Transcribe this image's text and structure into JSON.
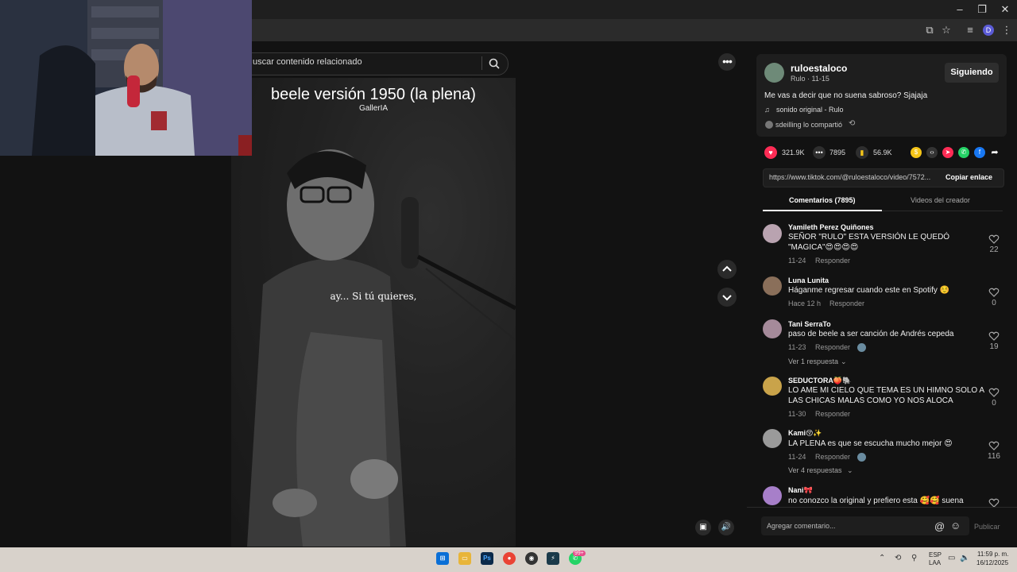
{
  "browser": {
    "minimize_icon": "minimize-icon",
    "restore_icon": "restore-icon",
    "close_icon": "close-icon",
    "profile_initial": "D"
  },
  "search": {
    "text": "uscar contenido relacionado"
  },
  "video": {
    "title": "beele versión 1950 (la plena)",
    "subtitle": "GallerIA",
    "caption": "ay... Si tú quieres,"
  },
  "post": {
    "username": "ruloestaloco",
    "meta": "Rulo · 11-15",
    "follow_label": "Siguiendo",
    "description": "Me vas a decir que no suena sabroso? Sjajaja",
    "sound": "sonido original - Rulo",
    "shared": "sdeilling lo compartió",
    "likes": "321.9K",
    "comments": "7895",
    "saves": "56.9K",
    "link": "https://www.tiktok.com/@ruloestaloco/video/7572...",
    "copy_label": "Copiar enlace"
  },
  "tabs": [
    {
      "label": "Comentarios (7895)"
    },
    {
      "label": "Videos del creador"
    }
  ],
  "comments": [
    {
      "user": "Yamileth Perez Quiñones",
      "line1": "SEÑOR \"RULO\" ESTA VERSIÓN LE QUEDÓ",
      "line2": "\"MAGICA\"😍😍😍😍",
      "date": "11-24",
      "reply": "Responder",
      "likes": "22",
      "color": "#b9a3b0"
    },
    {
      "user": "Luna Lunita",
      "line1": "Háganme regresar cuando este en Spotify ☺️",
      "date": "Hace 12 h",
      "reply": "Responder",
      "likes": "0",
      "color": "#8a6f5a"
    },
    {
      "user": "Tani SerraTo",
      "line1": "paso de beele a ser canción de Andrés cepeda",
      "date": "11-23",
      "reply": "Responder",
      "likes": "19",
      "more": "Ver 1 respuesta",
      "color": "#a58a9a"
    },
    {
      "user": "SEDUCTORA🍑🐘",
      "line1": "LO AME MI CIELO QUE TEMA ES UN HIMNO SOLO A",
      "line2": "LAS CHICAS MALAS COMO YO NOS ALOCA",
      "date": "11-30",
      "reply": "Responder",
      "likes": "0",
      "color": "#c9a34a"
    },
    {
      "user": "Kami😚✨",
      "line1": "LA PLENA es que se escucha mucho mejor 😍",
      "date": "11-24",
      "reply": "Responder",
      "likes": "116",
      "more": "Ver 4 respuestas",
      "color": "#9a9a9a"
    },
    {
      "user": "Nani🎀",
      "line1": "no conozco la original y prefiero esta 🥰🥰 suena",
      "date": "",
      "reply": "",
      "likes": "",
      "color": "#a77fc9"
    }
  ],
  "composer": {
    "placeholder": "Agregar comentario...",
    "publish_label": "Publicar"
  },
  "taskbar": {
    "lang1": "ESP",
    "lang2": "LAA",
    "time": "11:59 p. m.",
    "date": "16/12/2025",
    "badge": "99+"
  },
  "colors": {
    "accent_red": "#fe2c55",
    "bg": "#121212",
    "panel": "#1e1e1e"
  }
}
